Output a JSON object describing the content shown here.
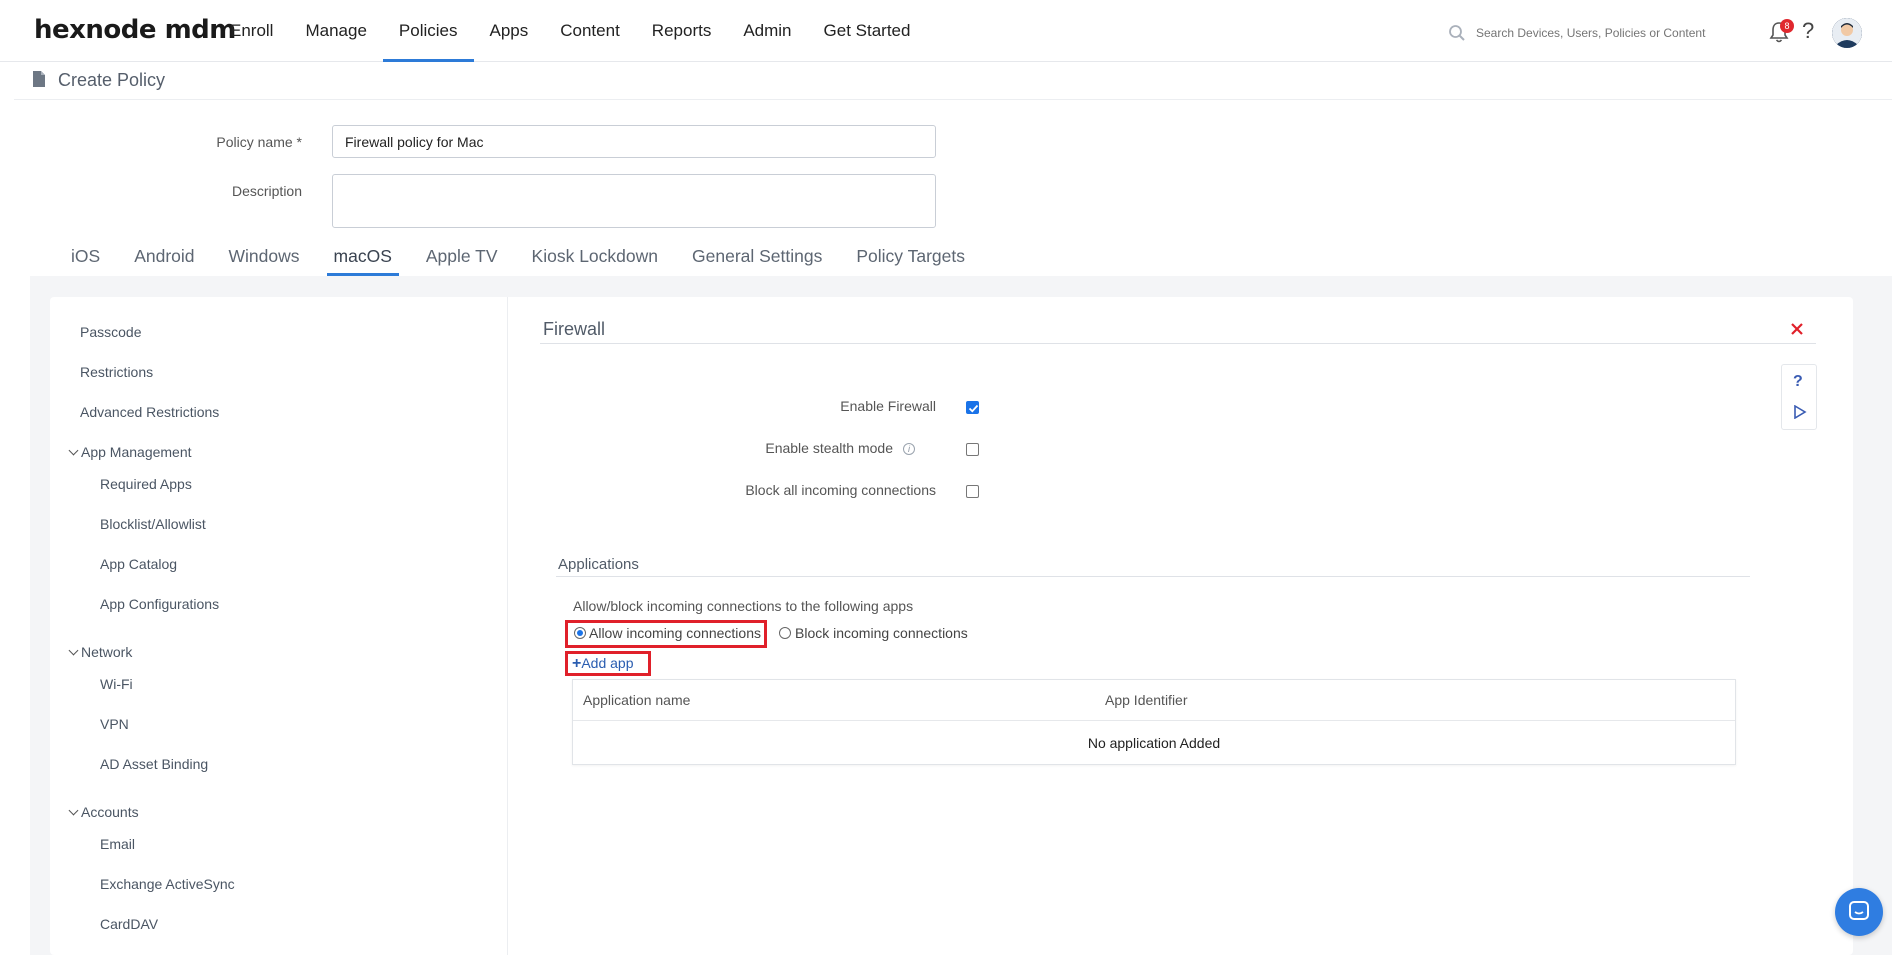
{
  "nav": {
    "logo": "hexnode mdm",
    "items": [
      "Enroll",
      "Manage",
      "Policies",
      "Apps",
      "Content",
      "Reports",
      "Admin",
      "Get Started"
    ],
    "active": "Policies",
    "search_placeholder": "Search Devices, Users, Policies or Content",
    "notification_count": "8"
  },
  "page": {
    "title": "Create Policy"
  },
  "form": {
    "policy_name_label": "Policy name *",
    "policy_name_value": "Firewall policy for Mac",
    "description_label": "Description",
    "description_value": ""
  },
  "os_tabs": [
    "iOS",
    "Android",
    "Windows",
    "macOS",
    "Apple TV",
    "Kiosk Lockdown",
    "General Settings",
    "Policy Targets"
  ],
  "os_tab_active": "macOS",
  "sidebar": {
    "top_items": [
      "Passcode",
      "Restrictions",
      "Advanced Restrictions"
    ],
    "groups": [
      {
        "label": "App Management",
        "items": [
          "Required Apps",
          "Blocklist/Allowlist",
          "App Catalog",
          "App Configurations"
        ]
      },
      {
        "label": "Network",
        "items": [
          "Wi-Fi",
          "VPN",
          "AD Asset Binding"
        ]
      },
      {
        "label": "Accounts",
        "items": [
          "Email",
          "Exchange ActiveSync",
          "CardDAV"
        ]
      }
    ]
  },
  "firewall": {
    "title": "Firewall",
    "options": [
      {
        "label": "Enable Firewall",
        "checked": true
      },
      {
        "label": "Enable stealth mode",
        "checked": false,
        "info": "i"
      },
      {
        "label": "Block all incoming connections",
        "checked": false
      }
    ],
    "applications": {
      "title": "Applications",
      "description": "Allow/block incoming connections to the following apps",
      "radio_allow": "Allow incoming connections",
      "radio_block": "Block incoming connections",
      "selected": "allow",
      "add_app": "Add app",
      "table": {
        "col1": "Application name",
        "col2": "App Identifier",
        "empty": "No application Added"
      }
    }
  },
  "colors": {
    "accent": "#2d7bd8",
    "highlight": "#e0202a",
    "chat": "#2f7de1"
  }
}
